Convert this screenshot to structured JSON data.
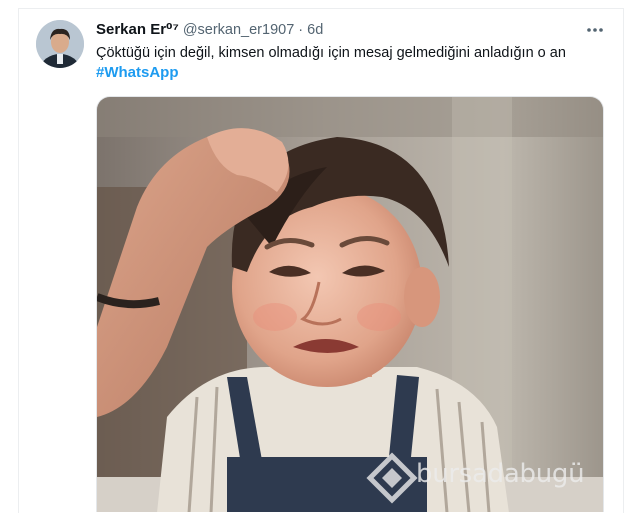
{
  "tweet": {
    "display_name": "Serkan Er⁰⁷",
    "handle": "@serkan_er1907",
    "separator": "·",
    "time": "6d",
    "text": "Çöktüğü için değil, kimsen olmadığı için mesaj gelmediğini anladığın o an",
    "hashtag": "#WhatsApp",
    "more_icon": "more-horizontal-icon",
    "media_description_icon": "photo"
  },
  "watermark": {
    "text": "bursadabugü"
  },
  "colors": {
    "text_primary": "#0f1419",
    "text_secondary": "#536471",
    "link": "#1d9bf0"
  }
}
